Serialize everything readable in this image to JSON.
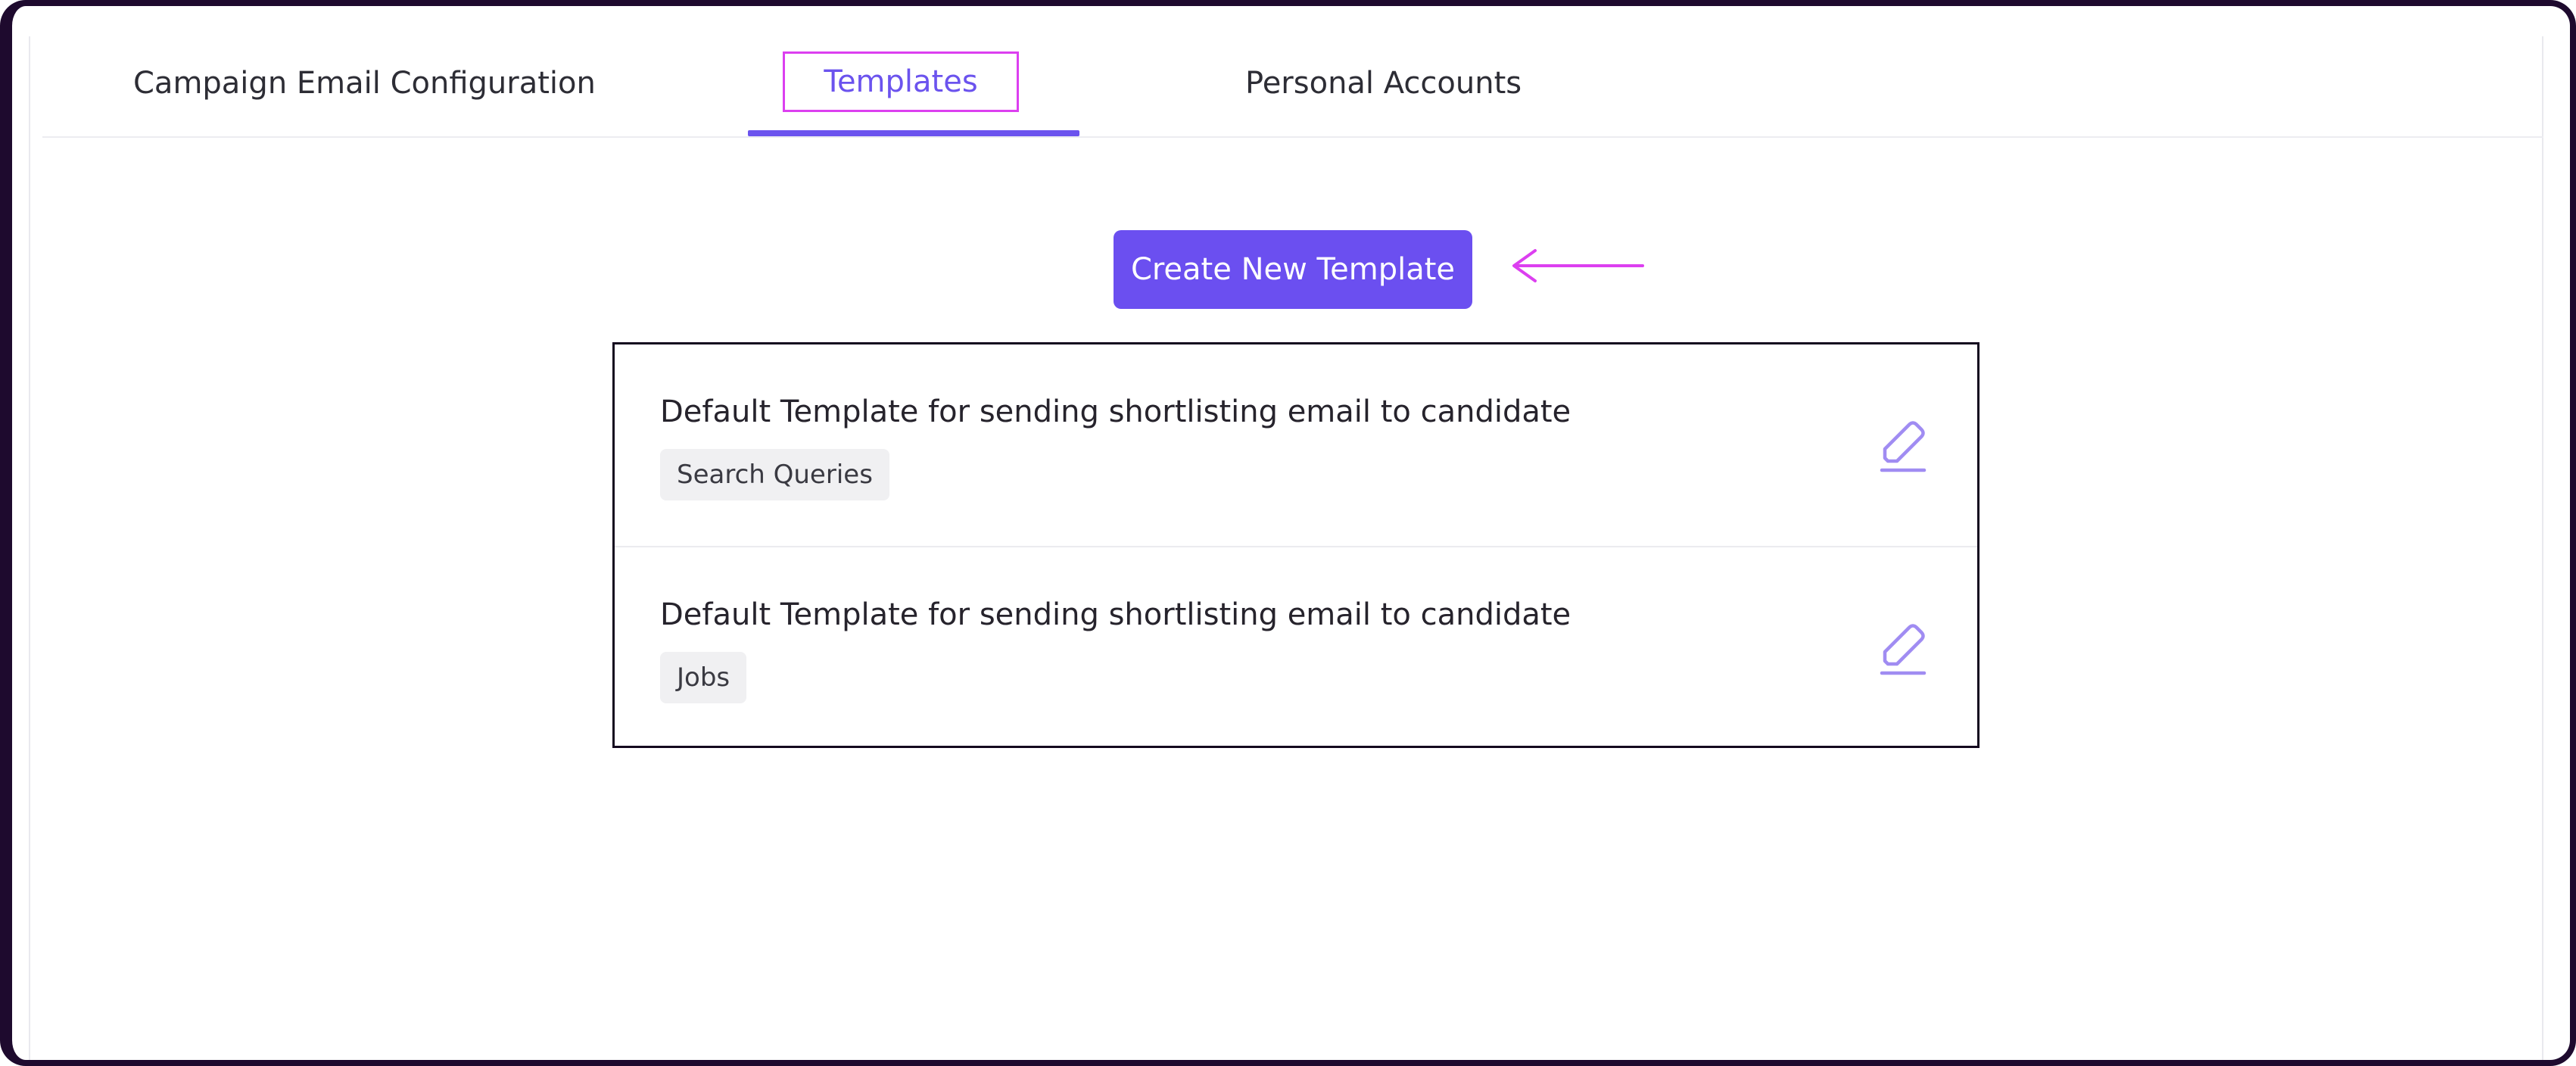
{
  "tabs": {
    "campaign": "Campaign Email Configuration",
    "templates": "Templates",
    "personal": "Personal Accounts",
    "active": "Templates"
  },
  "actions": {
    "create_label": "Create New Template"
  },
  "templates": [
    {
      "title": "Default Template for sending shortlisting email to candidate",
      "tag": "Search Queries",
      "action_icon": "pencil-edit-icon"
    },
    {
      "title": "Default Template for sending shortlisting email to candidate",
      "tag": "Jobs",
      "action_icon": "pencil-edit-icon"
    }
  ],
  "colors": {
    "accent": "#6b4ff0",
    "highlight": "#dc3ff0",
    "icon": "#a08cf2",
    "frame": "#1e0a2e"
  }
}
